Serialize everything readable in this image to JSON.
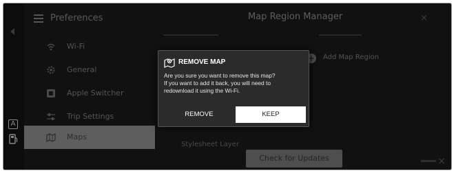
{
  "header": {
    "title": "Preferences",
    "page_title": "Map Region Manager",
    "close_symbol": "×"
  },
  "sidebar": {
    "items": [
      {
        "label": "Wi-Fi",
        "icon": "wifi-icon",
        "selected": false
      },
      {
        "label": "General",
        "icon": "gear-icon",
        "selected": false
      },
      {
        "label": "Apple Switcher",
        "icon": "switch-icon",
        "selected": false
      },
      {
        "label": "Trip Settings",
        "icon": "sliders-icon",
        "selected": false
      },
      {
        "label": "Maps",
        "icon": "map-icon",
        "selected": true
      }
    ]
  },
  "main": {
    "add_label": "Add Map Region",
    "layer_label": "Stylesheet Layer",
    "check_updates_label": "Check for Updates"
  },
  "rail": {
    "a_label": "A"
  },
  "dialog": {
    "icon": "map-remove-icon",
    "title": "REMOVE MAP",
    "body_line1": "Are you sure you want to remove this map?",
    "body_line2": "If you want to add it back, you will need to",
    "body_line3": "redownload it using the Wi-Fi.",
    "remove_label": "REMOVE",
    "keep_label": "KEEP"
  },
  "colors": {
    "background": "#111111",
    "dialog_bg": "#2b2b2b",
    "selected_item": "#5e5e5e",
    "keep_button": "#ffffff"
  }
}
